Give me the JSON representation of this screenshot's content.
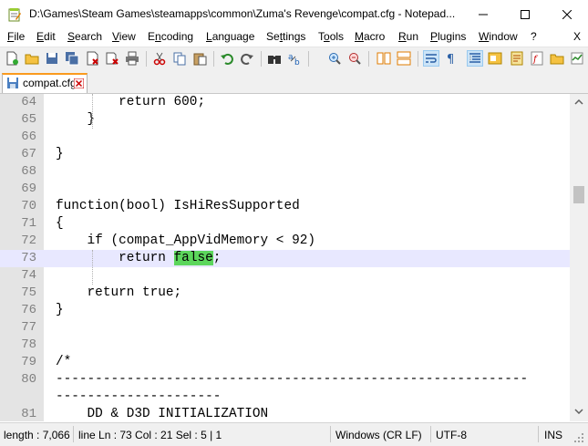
{
  "window": {
    "title": "D:\\Games\\Steam Games\\steamapps\\common\\Zuma's Revenge\\compat.cfg - Notepad...",
    "minimize_icon": "minimize-icon",
    "maximize_icon": "maximize-icon",
    "close_icon": "close-icon"
  },
  "menu": [
    {
      "label": "File",
      "u": "F"
    },
    {
      "label": "Edit",
      "u": "E"
    },
    {
      "label": "Search",
      "u": "S"
    },
    {
      "label": "View",
      "u": "V"
    },
    {
      "label": "Encoding",
      "u": "n"
    },
    {
      "label": "Language",
      "u": "L"
    },
    {
      "label": "Settings",
      "u": "t"
    },
    {
      "label": "Tools",
      "u": "o"
    },
    {
      "label": "Macro",
      "u": "M"
    },
    {
      "label": "Run",
      "u": "R"
    },
    {
      "label": "Plugins",
      "u": "P"
    },
    {
      "label": "Window",
      "u": "W"
    },
    {
      "label": "?",
      "u": ""
    }
  ],
  "menu_close": "X",
  "tab": {
    "label": "compat.cfg",
    "close_icon": "tab-close-icon"
  },
  "editor": {
    "lines": [
      {
        "n": "64",
        "code": "        return 600;"
      },
      {
        "n": "65",
        "code": "    }"
      },
      {
        "n": "66",
        "code": ""
      },
      {
        "n": "67",
        "code": "}"
      },
      {
        "n": "68",
        "code": ""
      },
      {
        "n": "69",
        "code": ""
      },
      {
        "n": "70",
        "code": "function(bool) IsHiResSupported"
      },
      {
        "n": "71",
        "code": "{"
      },
      {
        "n": "72",
        "code": "    if (compat_AppVidMemory < 92)"
      },
      {
        "n": "73",
        "code_before": "        return ",
        "code_highlight": "false",
        "code_after": ";",
        "current": true
      },
      {
        "n": "74",
        "code": ""
      },
      {
        "n": "75",
        "code": "    return true;"
      },
      {
        "n": "76",
        "code": "}"
      },
      {
        "n": "77",
        "code": ""
      },
      {
        "n": "78",
        "code": ""
      },
      {
        "n": "79",
        "code": "/*"
      },
      {
        "n": "80",
        "code": "------------------------------------------------------------"
      },
      {
        "n": "",
        "code": "---------------------"
      },
      {
        "n": "81",
        "code": "    DD & D3D INITIALIZATION"
      }
    ]
  },
  "status": {
    "length": "length : 7,066",
    "position": "line Ln : 73    Col : 21    Sel : 5 | 1",
    "eol": "Windows (CR LF)",
    "encoding": "UTF-8",
    "mode": "INS"
  },
  "colors": {
    "highlight": "#5cd65c",
    "current_line": "#e8e8ff",
    "tab_accent": "#fa9a1e"
  }
}
